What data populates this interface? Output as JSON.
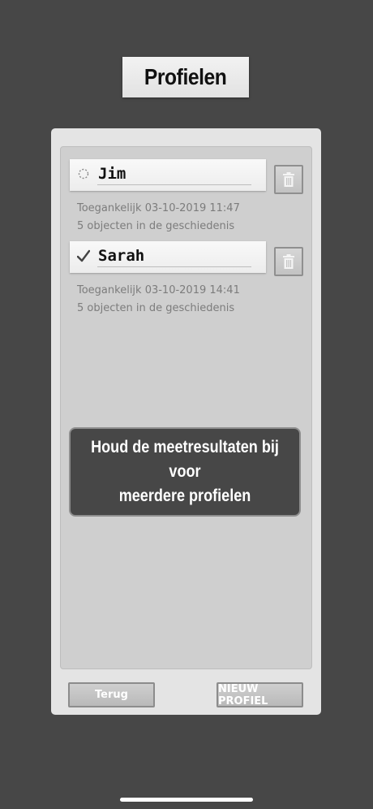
{
  "header": {
    "title": "Profielen"
  },
  "profiles": [
    {
      "name": "Jim",
      "accessed": "Toegankelijk 03-10-2019 11:47",
      "history": "5 objecten in de geschiedenis",
      "status_icon": "dashed-circle-icon",
      "active": false
    },
    {
      "name": "Sarah",
      "accessed": "Toegankelijk 03-10-2019 14:41",
      "history": "5 objecten in de geschiedenis",
      "status_icon": "checkmark-icon",
      "active": true
    }
  ],
  "banner": {
    "text": "Houd de meetresultaten bij voor\nmeerdere profielen"
  },
  "buttons": {
    "back_label": "Terug",
    "new_profile_label": "NIEUW PROFIEL"
  },
  "icons": {
    "delete": "trash-icon"
  },
  "colors": {
    "background": "#474747",
    "panel": "#e4e4e4",
    "inner_panel": "#cfcfcf"
  }
}
